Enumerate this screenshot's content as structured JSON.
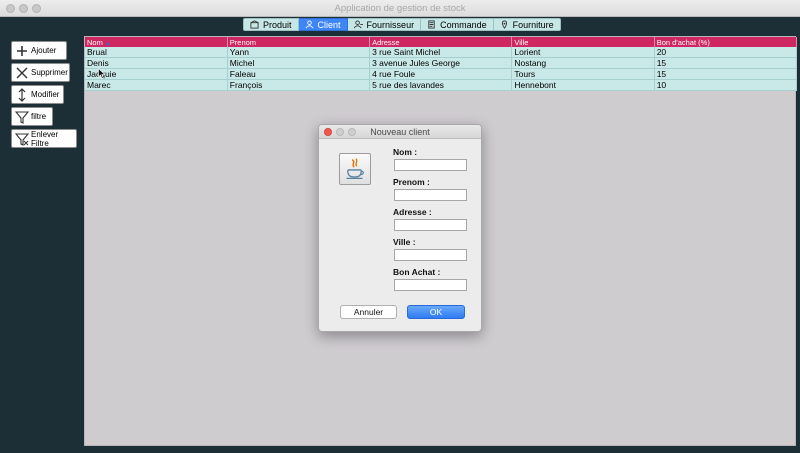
{
  "window": {
    "title": "Application de gestion de stock"
  },
  "tabs": [
    {
      "label": "Produit",
      "icon": "product-icon",
      "active": false
    },
    {
      "label": "Client",
      "icon": "client-icon",
      "active": true
    },
    {
      "label": "Fournisseur",
      "icon": "supplier-icon",
      "active": false
    },
    {
      "label": "Commande",
      "icon": "order-icon",
      "active": false
    },
    {
      "label": "Fourniture",
      "icon": "supply-icon",
      "active": false
    }
  ],
  "sidebar": {
    "add": "Ajouter",
    "delete": "Supprimer",
    "edit": "Modifier",
    "filter": "filtre",
    "remove_filter": "Enlever Filtre"
  },
  "table": {
    "columns": [
      "Nom",
      "Prenom",
      "Adresse",
      "Ville",
      "Bon d'achat (%)"
    ],
    "rows": [
      [
        "Brual",
        "Yann",
        "3 rue Saint Michel",
        "Lorient",
        "20"
      ],
      [
        "Denis",
        "Michel",
        "3 avenue Jules George",
        "Nostang",
        "15"
      ],
      [
        "Jacquie",
        "Faleau",
        "4 rue Foule",
        "Tours",
        "15"
      ],
      [
        "Marec",
        "François",
        "5 rue des lavandes",
        "Hennebont",
        "10"
      ]
    ]
  },
  "dialog": {
    "title": "Nouveau client",
    "fields": {
      "nom": {
        "label": "Nom :",
        "value": ""
      },
      "prenom": {
        "label": "Prenom :",
        "value": ""
      },
      "adresse": {
        "label": "Adresse :",
        "value": ""
      },
      "ville": {
        "label": "Ville :",
        "value": ""
      },
      "bon_achat": {
        "label": "Bon Achat :",
        "value": ""
      }
    },
    "cancel": "Annuler",
    "ok": "OK"
  },
  "colors": {
    "header": "#cf2762",
    "row": "#c9e9e8",
    "active_tab": "#3e86f5",
    "background": "#1c2f37"
  }
}
